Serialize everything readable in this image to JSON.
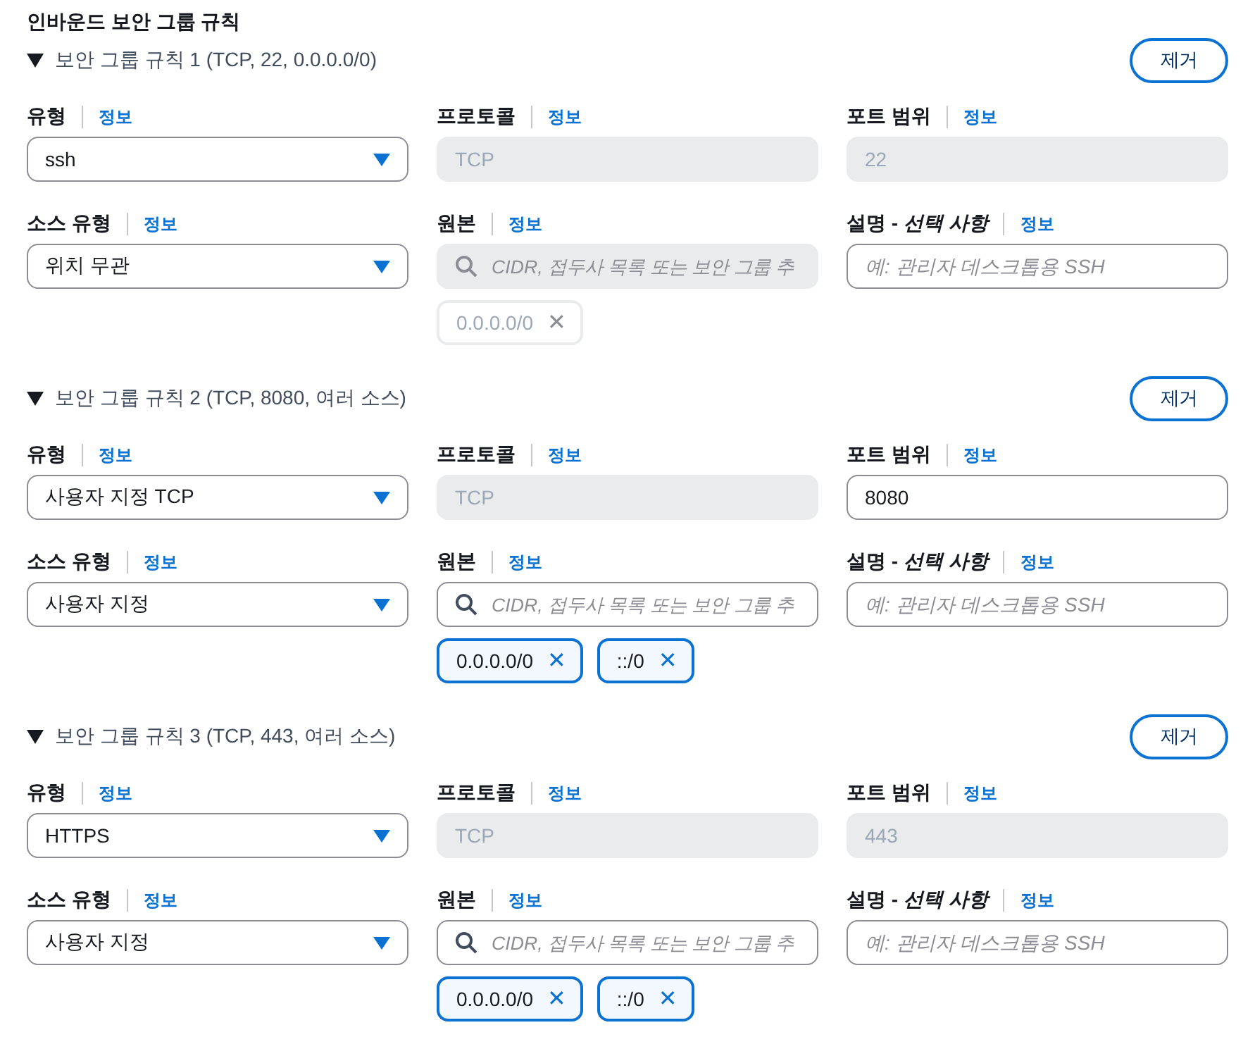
{
  "section_title": "인바운드 보안 그룹 규칙",
  "rules": [
    {
      "title": "보안 그룹 규칙 1 (TCP, 22, 0.0.0.0/0)",
      "expanded": true,
      "remove_button": "제거",
      "type": {
        "label": "유형",
        "info": "정보",
        "value": "ssh"
      },
      "protocol": {
        "label": "프로토콜",
        "info": "정보",
        "value": "TCP",
        "disabled": true
      },
      "port_range": {
        "label": "포트 범위",
        "info": "정보",
        "value": "22",
        "disabled": true
      },
      "source_type": {
        "label": "소스 유형",
        "info": "정보",
        "value": "위치 무관"
      },
      "source": {
        "label": "원본",
        "info": "정보",
        "placeholder": "CIDR, 접두사 목록 또는 보안 그룹 추",
        "disabled": true,
        "tokens": [
          {
            "value": "0.0.0.0/0",
            "remove": "✕"
          }
        ]
      },
      "description": {
        "label": "설명 - *선택 사항*",
        "info": "정보",
        "placeholder": "예: 관리자 데스크톱용 SSH"
      }
    },
    {
      "title": "보안 그룹 규칙 2 (TCP, 8080, 여러 소스)",
      "expanded": true,
      "remove_button": "제거",
      "type": {
        "label": "유형",
        "info": "정보",
        "value": "사용자 지정 TCP"
      },
      "protocol": {
        "label": "프로토콜",
        "info": "정보",
        "value": "TCP",
        "disabled": true
      },
      "port_range": {
        "label": "포트 범위",
        "info": "정보",
        "value": "8080",
        "disabled": false
      },
      "source_type": {
        "label": "소스 유형",
        "info": "정보",
        "value": "사용자 지정"
      },
      "source": {
        "label": "원본",
        "info": "정보",
        "placeholder": "CIDR, 접두사 목록 또는 보안 그룹 추",
        "disabled": false,
        "tokens": [
          {
            "value": "0.0.0.0/0",
            "remove": "✕"
          },
          {
            "value": "::/0",
            "remove": "✕"
          }
        ]
      },
      "description": {
        "label": "설명 - *선택 사항*",
        "info": "정보",
        "placeholder": "예: 관리자 데스크톱용 SSH"
      }
    },
    {
      "title": "보안 그룹 규칙 3 (TCP, 443, 여러 소스)",
      "expanded": true,
      "remove_button": "제거",
      "type": {
        "label": "유형",
        "info": "정보",
        "value": "HTTPS"
      },
      "protocol": {
        "label": "프로토콜",
        "info": "정보",
        "value": "TCP",
        "disabled": true
      },
      "port_range": {
        "label": "포트 범위",
        "info": "정보",
        "value": "443",
        "disabled": true
      },
      "source_type": {
        "label": "소스 유형",
        "info": "정보",
        "value": "사용자 지정"
      },
      "source": {
        "label": "원본",
        "info": "정보",
        "placeholder": "CIDR, 접두사 목록 또는 보안 그룹 추",
        "disabled": false,
        "tokens": [
          {
            "value": "0.0.0.0/0",
            "remove": "✕"
          },
          {
            "value": "::/0",
            "remove": "✕"
          }
        ]
      },
      "description": {
        "label": "설명 - *선택 사항*",
        "info": "정보",
        "placeholder": "예: 관리자 데스크톱용 SSH"
      }
    }
  ]
}
